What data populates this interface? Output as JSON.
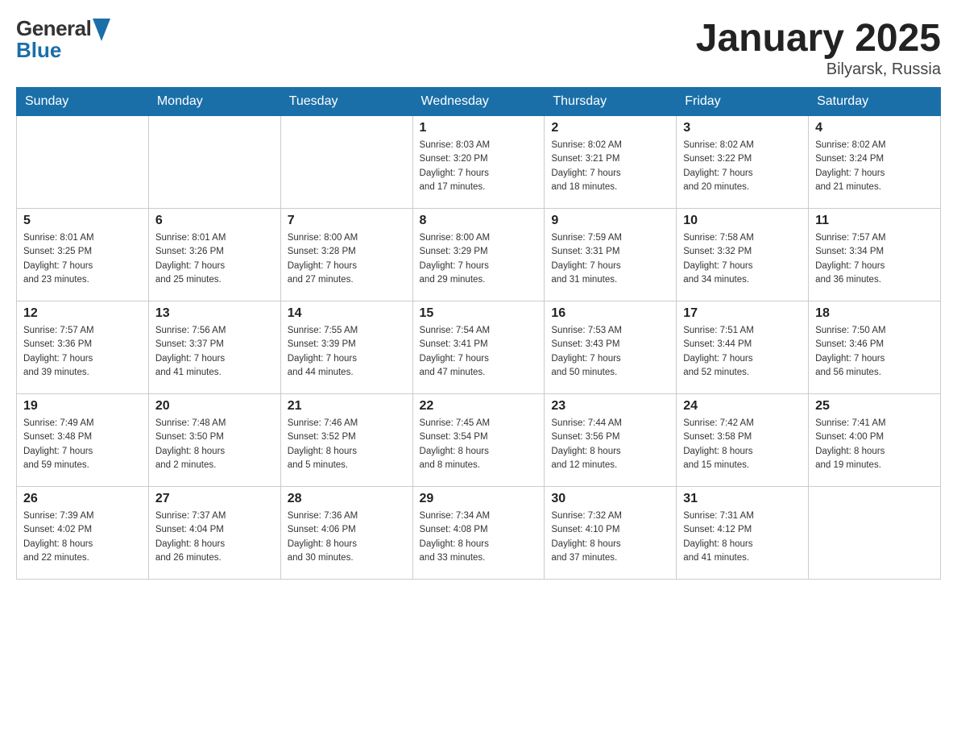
{
  "header": {
    "logo_text_general": "General",
    "logo_text_blue": "Blue",
    "title": "January 2025",
    "subtitle": "Bilyarsk, Russia"
  },
  "days_of_week": [
    "Sunday",
    "Monday",
    "Tuesday",
    "Wednesday",
    "Thursday",
    "Friday",
    "Saturday"
  ],
  "weeks": [
    [
      {
        "day": "",
        "info": ""
      },
      {
        "day": "",
        "info": ""
      },
      {
        "day": "",
        "info": ""
      },
      {
        "day": "1",
        "info": "Sunrise: 8:03 AM\nSunset: 3:20 PM\nDaylight: 7 hours\nand 17 minutes."
      },
      {
        "day": "2",
        "info": "Sunrise: 8:02 AM\nSunset: 3:21 PM\nDaylight: 7 hours\nand 18 minutes."
      },
      {
        "day": "3",
        "info": "Sunrise: 8:02 AM\nSunset: 3:22 PM\nDaylight: 7 hours\nand 20 minutes."
      },
      {
        "day": "4",
        "info": "Sunrise: 8:02 AM\nSunset: 3:24 PM\nDaylight: 7 hours\nand 21 minutes."
      }
    ],
    [
      {
        "day": "5",
        "info": "Sunrise: 8:01 AM\nSunset: 3:25 PM\nDaylight: 7 hours\nand 23 minutes."
      },
      {
        "day": "6",
        "info": "Sunrise: 8:01 AM\nSunset: 3:26 PM\nDaylight: 7 hours\nand 25 minutes."
      },
      {
        "day": "7",
        "info": "Sunrise: 8:00 AM\nSunset: 3:28 PM\nDaylight: 7 hours\nand 27 minutes."
      },
      {
        "day": "8",
        "info": "Sunrise: 8:00 AM\nSunset: 3:29 PM\nDaylight: 7 hours\nand 29 minutes."
      },
      {
        "day": "9",
        "info": "Sunrise: 7:59 AM\nSunset: 3:31 PM\nDaylight: 7 hours\nand 31 minutes."
      },
      {
        "day": "10",
        "info": "Sunrise: 7:58 AM\nSunset: 3:32 PM\nDaylight: 7 hours\nand 34 minutes."
      },
      {
        "day": "11",
        "info": "Sunrise: 7:57 AM\nSunset: 3:34 PM\nDaylight: 7 hours\nand 36 minutes."
      }
    ],
    [
      {
        "day": "12",
        "info": "Sunrise: 7:57 AM\nSunset: 3:36 PM\nDaylight: 7 hours\nand 39 minutes."
      },
      {
        "day": "13",
        "info": "Sunrise: 7:56 AM\nSunset: 3:37 PM\nDaylight: 7 hours\nand 41 minutes."
      },
      {
        "day": "14",
        "info": "Sunrise: 7:55 AM\nSunset: 3:39 PM\nDaylight: 7 hours\nand 44 minutes."
      },
      {
        "day": "15",
        "info": "Sunrise: 7:54 AM\nSunset: 3:41 PM\nDaylight: 7 hours\nand 47 minutes."
      },
      {
        "day": "16",
        "info": "Sunrise: 7:53 AM\nSunset: 3:43 PM\nDaylight: 7 hours\nand 50 minutes."
      },
      {
        "day": "17",
        "info": "Sunrise: 7:51 AM\nSunset: 3:44 PM\nDaylight: 7 hours\nand 52 minutes."
      },
      {
        "day": "18",
        "info": "Sunrise: 7:50 AM\nSunset: 3:46 PM\nDaylight: 7 hours\nand 56 minutes."
      }
    ],
    [
      {
        "day": "19",
        "info": "Sunrise: 7:49 AM\nSunset: 3:48 PM\nDaylight: 7 hours\nand 59 minutes."
      },
      {
        "day": "20",
        "info": "Sunrise: 7:48 AM\nSunset: 3:50 PM\nDaylight: 8 hours\nand 2 minutes."
      },
      {
        "day": "21",
        "info": "Sunrise: 7:46 AM\nSunset: 3:52 PM\nDaylight: 8 hours\nand 5 minutes."
      },
      {
        "day": "22",
        "info": "Sunrise: 7:45 AM\nSunset: 3:54 PM\nDaylight: 8 hours\nand 8 minutes."
      },
      {
        "day": "23",
        "info": "Sunrise: 7:44 AM\nSunset: 3:56 PM\nDaylight: 8 hours\nand 12 minutes."
      },
      {
        "day": "24",
        "info": "Sunrise: 7:42 AM\nSunset: 3:58 PM\nDaylight: 8 hours\nand 15 minutes."
      },
      {
        "day": "25",
        "info": "Sunrise: 7:41 AM\nSunset: 4:00 PM\nDaylight: 8 hours\nand 19 minutes."
      }
    ],
    [
      {
        "day": "26",
        "info": "Sunrise: 7:39 AM\nSunset: 4:02 PM\nDaylight: 8 hours\nand 22 minutes."
      },
      {
        "day": "27",
        "info": "Sunrise: 7:37 AM\nSunset: 4:04 PM\nDaylight: 8 hours\nand 26 minutes."
      },
      {
        "day": "28",
        "info": "Sunrise: 7:36 AM\nSunset: 4:06 PM\nDaylight: 8 hours\nand 30 minutes."
      },
      {
        "day": "29",
        "info": "Sunrise: 7:34 AM\nSunset: 4:08 PM\nDaylight: 8 hours\nand 33 minutes."
      },
      {
        "day": "30",
        "info": "Sunrise: 7:32 AM\nSunset: 4:10 PM\nDaylight: 8 hours\nand 37 minutes."
      },
      {
        "day": "31",
        "info": "Sunrise: 7:31 AM\nSunset: 4:12 PM\nDaylight: 8 hours\nand 41 minutes."
      },
      {
        "day": "",
        "info": ""
      }
    ]
  ]
}
